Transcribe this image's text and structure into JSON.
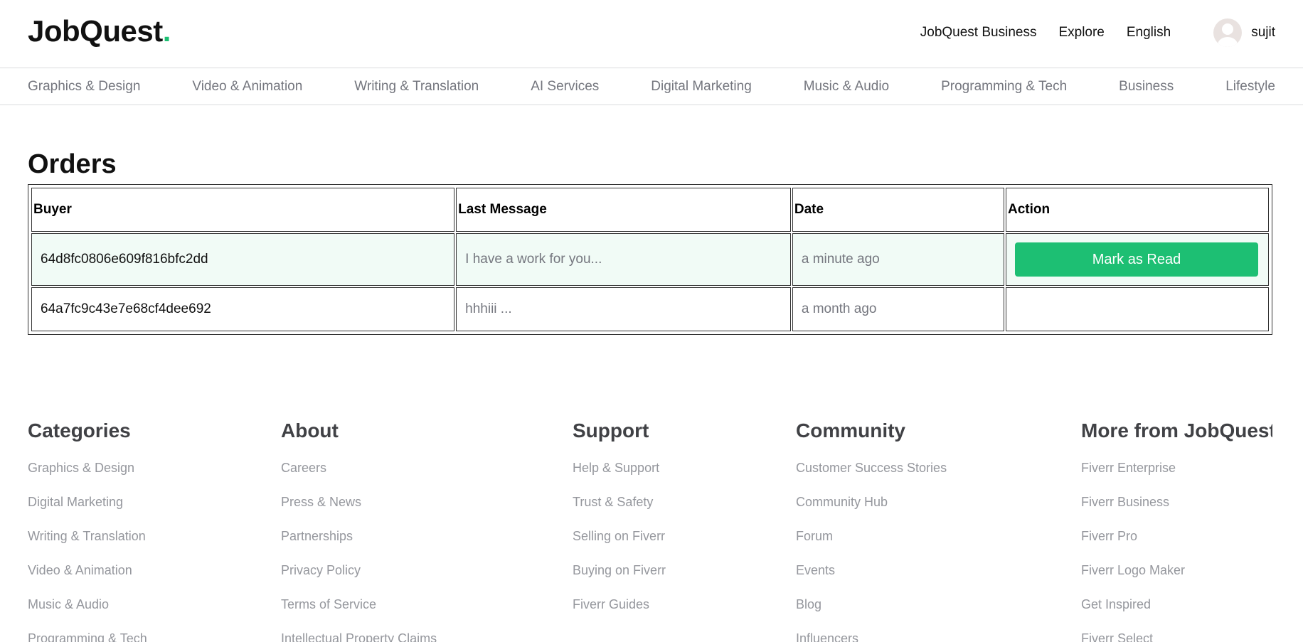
{
  "header": {
    "logo_text": "JobQuest",
    "logo_dot": ".",
    "nav": [
      "JobQuest Business",
      "Explore",
      "English"
    ],
    "username": "sujit"
  },
  "categories": [
    "Graphics & Design",
    "Video & Animation",
    "Writing & Translation",
    "AI Services",
    "Digital Marketing",
    "Music & Audio",
    "Programming & Tech",
    "Business",
    "Lifestyle"
  ],
  "orders": {
    "title": "Orders",
    "columns": [
      "Buyer",
      "Last Message",
      "Date",
      "Action"
    ],
    "rows": [
      {
        "buyer": "64d8fc0806e609f816bfc2dd",
        "message": "I have a work for you...",
        "date": "a minute ago",
        "action": "Mark as Read"
      },
      {
        "buyer": "64a7fc9c43e7e68cf4dee692",
        "message": "hhhiii ...",
        "date": "a month ago",
        "action": ""
      }
    ]
  },
  "footer": {
    "columns": [
      {
        "title": "Categories",
        "links": [
          "Graphics & Design",
          "Digital Marketing",
          "Writing & Translation",
          "Video & Animation",
          "Music & Audio",
          "Programming & Tech"
        ]
      },
      {
        "title": "About",
        "links": [
          "Careers",
          "Press & News",
          "Partnerships",
          "Privacy Policy",
          "Terms of Service",
          "Intellectual Property Claims"
        ]
      },
      {
        "title": "Support",
        "links": [
          "Help & Support",
          "Trust & Safety",
          "Selling on Fiverr",
          "Buying on Fiverr",
          "Fiverr Guides"
        ]
      },
      {
        "title": "Community",
        "links": [
          "Customer Success Stories",
          "Community Hub",
          "Forum",
          "Events",
          "Blog",
          "Influencers"
        ]
      },
      {
        "title": "More from JobQuest",
        "links": [
          "Fiverr Enterprise",
          "Fiverr Business",
          "Fiverr Pro",
          "Fiverr Logo Maker",
          "Get Inspired",
          "Fiverr Select"
        ]
      }
    ]
  },
  "colors": {
    "accent": "#1dbf73",
    "unread_row": "#f1fbf6",
    "muted_text": "#74767e",
    "footer_link": "#95979d"
  }
}
